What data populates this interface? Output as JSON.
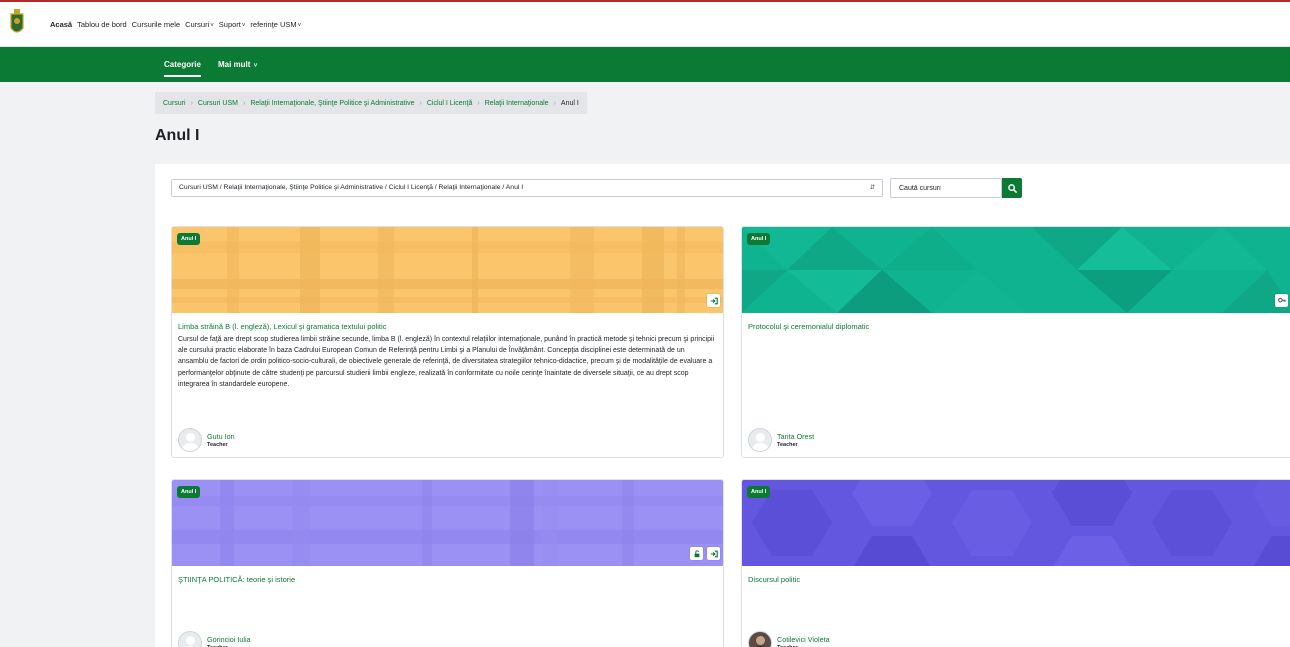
{
  "topnav": {
    "items": [
      {
        "label": "Acasă",
        "dropdown": false
      },
      {
        "label": "Tablou de bord",
        "dropdown": false
      },
      {
        "label": "Cursurile mele",
        "dropdown": false
      },
      {
        "label": "Cursuri",
        "dropdown": true
      },
      {
        "label": "Suport",
        "dropdown": true
      },
      {
        "label": "referinţe USM",
        "dropdown": true
      }
    ],
    "logo_icon": "coat-of-arms-logo"
  },
  "secondary_nav": {
    "tabs": [
      {
        "label": "Categorie",
        "active": true
      },
      {
        "label": "Mai mult",
        "dropdown": true
      }
    ]
  },
  "breadcrumb": [
    "Cursuri",
    "Cursuri USM",
    "Relaţii Internaţionale, Ştiinţe Politice şi Administrative",
    "Ciclul I Licenţă",
    "Relaţii Internaţionale",
    "Anul I"
  ],
  "page_title": "Anul I",
  "category_select": {
    "value": "Cursuri USM / Relaţii Internaţionale, Ştiinţe Politice şi Administrative / Ciclul I Licenţă / Relaţii Internaţionale / Anul I"
  },
  "course_search": {
    "placeholder": "Caută cursuri",
    "button_icon": "search-icon"
  },
  "colors": {
    "brand_green": "#0b7a34",
    "top_border": "#b72a2a"
  },
  "courses": [
    {
      "badge": "Anul I",
      "title": "Limba străină B (l. engleză), Lexicul şi gramatica textului politic",
      "summary": "Cursul de faţă are drept scop studierea limbii străine secunde, limba B (l. engleză) în contextul relaţiilor internaţionale, punând  în practică metode şi tehnici precum şi principii ale cursului practic elaborate în baza Cadrului European Comun de Referinţă pentru Limbi şi a Planului de Învăţământ. Concepţia disciplinei este determinată de un ansamblu de factori de ordin politico-socio-culturali, de obiectivele generale de referinţă, de diversitatea strategiilor tehnico-didactice, precum şi de modalităţile de evaluare a performanţelor obţinute de către studenţi pe parcursul studierii limbii engleze, realizată în conformitate cu noile cerinţe înaintate de diversele situaţii, ce au drept scop integrarea în standardele europene.",
      "teacher": "Gutu Ion",
      "role": "Teacher",
      "image_color": "#fbc66b",
      "icons": [
        "enrol-icon"
      ]
    },
    {
      "badge": "Anul I",
      "title": "Protocolul şi ceremonialul diplomatic",
      "summary": "",
      "teacher": "Tarita Orest",
      "role": "Teacher",
      "image_color": "#10b38f",
      "icons": [
        "guest-key-icon"
      ]
    },
    {
      "badge": "Anul I",
      "title": "ŞTIINŢA POLITICĂ: teorie şi istorie",
      "summary": "",
      "teacher": "Gorincioi Iulia",
      "role": "Teacher",
      "image_color": "#9b91f5",
      "icons": [
        "unlock-icon",
        "enrol-icon"
      ]
    },
    {
      "badge": "Anul I",
      "title": "Discursul politic",
      "summary": "",
      "teacher": "Cotilevici Violeta",
      "role": "Teacher",
      "image_color": "#6357e0",
      "icons": []
    }
  ]
}
